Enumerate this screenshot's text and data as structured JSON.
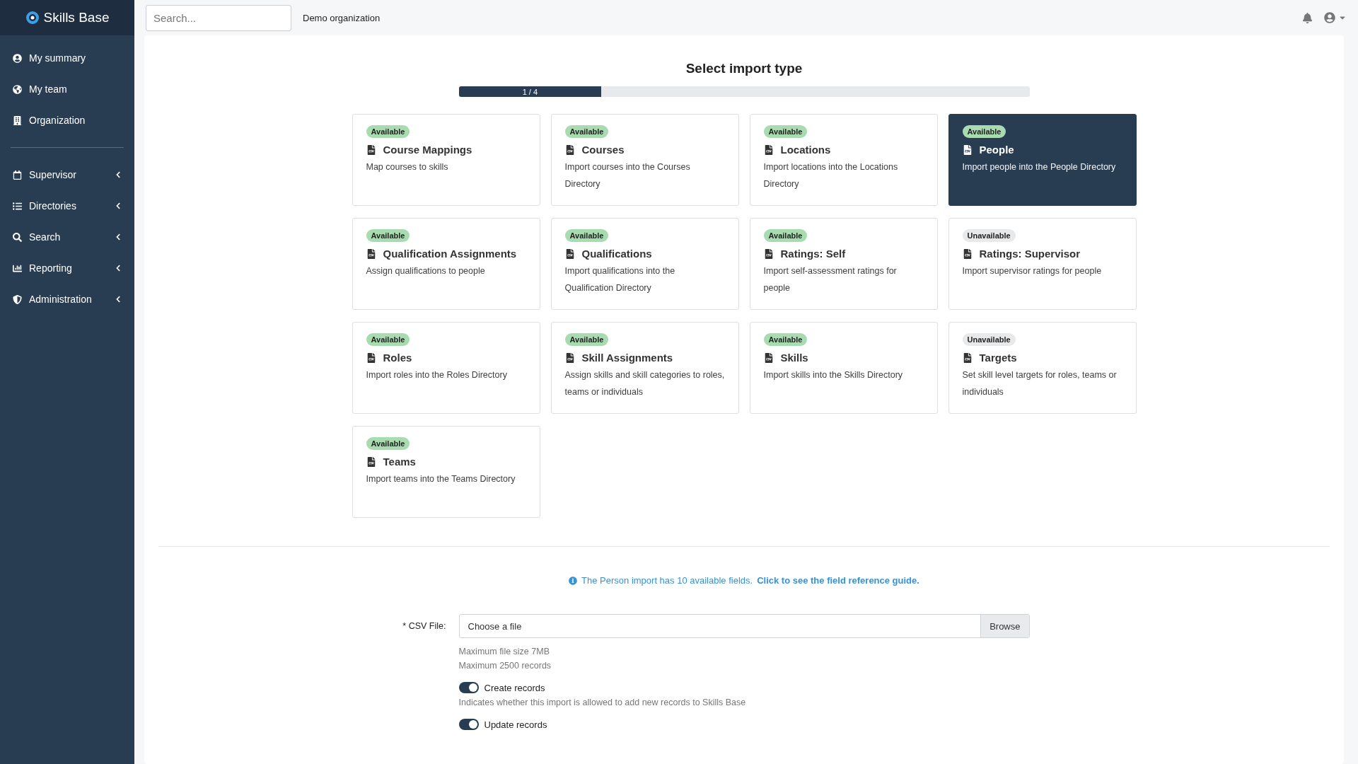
{
  "brand": {
    "name": "Skills Base"
  },
  "sidebar": {
    "groups": [
      {
        "items": [
          {
            "label": "My summary",
            "expandable": false
          },
          {
            "label": "My team",
            "expandable": false
          },
          {
            "label": "Organization",
            "expandable": false
          }
        ]
      },
      {
        "items": [
          {
            "label": "Supervisor",
            "expandable": true
          },
          {
            "label": "Directories",
            "expandable": true
          },
          {
            "label": "Search",
            "expandable": true
          },
          {
            "label": "Reporting",
            "expandable": true
          },
          {
            "label": "Administration",
            "expandable": true
          }
        ]
      }
    ]
  },
  "topbar": {
    "search": {
      "placeholder": "Search..."
    },
    "organization": "Demo organization"
  },
  "wizard": {
    "title": "Select import type",
    "progress": {
      "label": "1 / 4",
      "level": 0.25
    },
    "import_types": [
      {
        "status": "Available",
        "kind": "available",
        "title": "Course Mappings",
        "description": "Map courses to skills",
        "selected": false
      },
      {
        "status": "Available",
        "kind": "available",
        "title": "Courses",
        "description": "Import courses into the Courses Directory",
        "selected": false
      },
      {
        "status": "Available",
        "kind": "available",
        "title": "Locations",
        "description": "Import locations into the Locations Directory",
        "selected": false
      },
      {
        "status": "Available",
        "kind": "available",
        "title": "People",
        "description": "Import people into the People Directory",
        "selected": true
      },
      {
        "status": "Available",
        "kind": "available",
        "title": "Qualification Assignments",
        "description": "Assign qualifications to people",
        "selected": false
      },
      {
        "status": "Available",
        "kind": "available",
        "title": "Qualifications",
        "description": "Import qualifications into the Qualification Directory",
        "selected": false
      },
      {
        "status": "Available",
        "kind": "available",
        "title": "Ratings: Self",
        "description": "Import self-assessment ratings for people",
        "selected": false
      },
      {
        "status": "Unavailable",
        "kind": "unavailable",
        "title": "Ratings: Supervisor",
        "description": "Import supervisor ratings for people",
        "selected": false
      },
      {
        "status": "Available",
        "kind": "available",
        "title": "Roles",
        "description": "Import roles into the Roles Directory",
        "selected": false
      },
      {
        "status": "Available",
        "kind": "available",
        "title": "Skill Assignments",
        "description": "Assign skills and skill categories to roles, teams or individuals",
        "selected": false
      },
      {
        "status": "Available",
        "kind": "available",
        "title": "Skills",
        "description": "Import skills into the Skills Directory",
        "selected": false
      },
      {
        "status": "Unavailable",
        "kind": "unavailable",
        "title": "Targets",
        "description": "Set skill level targets for roles, teams or individuals",
        "selected": false
      },
      {
        "status": "Available",
        "kind": "available",
        "title": "Teams",
        "description": "Import teams into the Teams Directory",
        "selected": false
      }
    ]
  },
  "info": {
    "text": "The Person import has 10 available fields.",
    "link": "Click to see the field reference guide."
  },
  "form": {
    "file_label": "* CSV File:",
    "file_placeholder": "Choose a file",
    "browse": "Browse",
    "hints": [
      "Maximum file size 7MB",
      "Maximum 2500 records"
    ],
    "toggles": [
      {
        "label": "Create records",
        "on": true,
        "hint": "Indicates whether this import is allowed to add new records to Skills Base"
      },
      {
        "label": "Update records",
        "on": true
      }
    ]
  }
}
